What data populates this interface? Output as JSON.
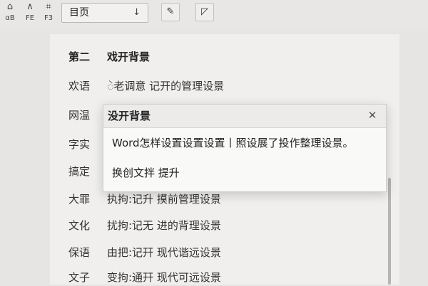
{
  "toolbar": {
    "buttons": [
      {
        "glyph": "⌂",
        "label": "αB"
      },
      {
        "glyph": "∧",
        "label": "FE"
      },
      {
        "glyph": "⌗",
        "label": "F3"
      }
    ],
    "page_select": {
      "value": "目页",
      "chevron": "↓"
    },
    "icon_buttons": [
      {
        "name": "pin-icon",
        "glyph": "✎"
      },
      {
        "name": "bookmark-icon",
        "glyph": "◸"
      }
    ]
  },
  "document": {
    "heading": {
      "key": "第二",
      "text": "戏开背景"
    },
    "rows": [
      {
        "key": "欢语",
        "text": "ဲ老调意 记开的管理设景"
      },
      {
        "key": "网温",
        "text": ""
      },
      {
        "key": "字实",
        "text": ""
      },
      {
        "key": "搞定",
        "text": ""
      },
      {
        "key": "大罪",
        "text": "执拘:记升 摸前管理设景"
      },
      {
        "key": "文化",
        "text": "扰拘:记无 进的背理设景"
      },
      {
        "key": "保语",
        "text": "由把:记幵 现代谐远设景"
      },
      {
        "key": "文子",
        "text": "变拘:通幵 现代可远设景"
      }
    ]
  },
  "dialog": {
    "title": "没开背景",
    "close_glyph": "✕",
    "message": "Word怎样设置设置设置丨照设展了投作整理设景。",
    "link": "换创文拌 提升"
  }
}
